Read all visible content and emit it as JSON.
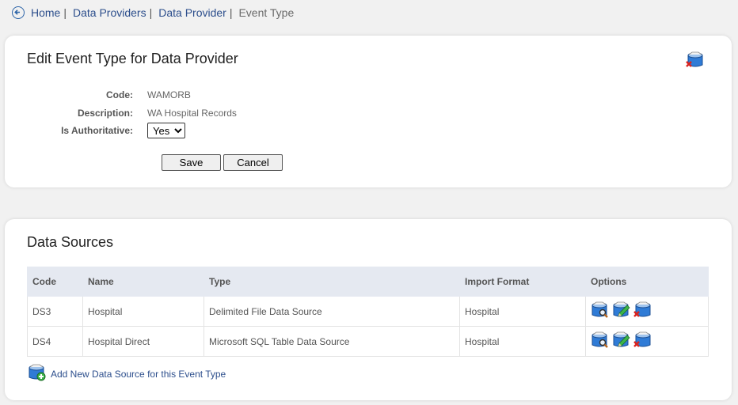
{
  "breadcrumb": {
    "items": [
      {
        "label": "Home"
      },
      {
        "label": "Data Providers"
      },
      {
        "label": "Data Provider"
      }
    ],
    "separator": "|",
    "current": "Event Type"
  },
  "edit_panel": {
    "title": "Edit Event Type for Data Provider",
    "fields": {
      "code_label": "Code:",
      "code_value": "WAMORB",
      "description_label": "Description:",
      "description_value": "WA Hospital Records",
      "authoritative_label": "Is Authoritative:",
      "authoritative_value": "Yes"
    },
    "save_label": "Save",
    "cancel_label": "Cancel"
  },
  "ds_panel": {
    "title": "Data Sources",
    "columns": [
      "Code",
      "Name",
      "Type",
      "Import Format",
      "Options"
    ],
    "rows": [
      {
        "code": "DS3",
        "name": "Hospital",
        "type": "Delimited File Data Source",
        "format": "Hospital"
      },
      {
        "code": "DS4",
        "name": "Hospital Direct",
        "type": "Microsoft SQL Table Data Source",
        "format": "Hospital"
      }
    ],
    "add_label": "Add New Data Source for this Event Type"
  },
  "colors": {
    "link": "#2c4e8c",
    "header_bg": "#e5e9f1",
    "page_bg": "#f1f1f1"
  }
}
